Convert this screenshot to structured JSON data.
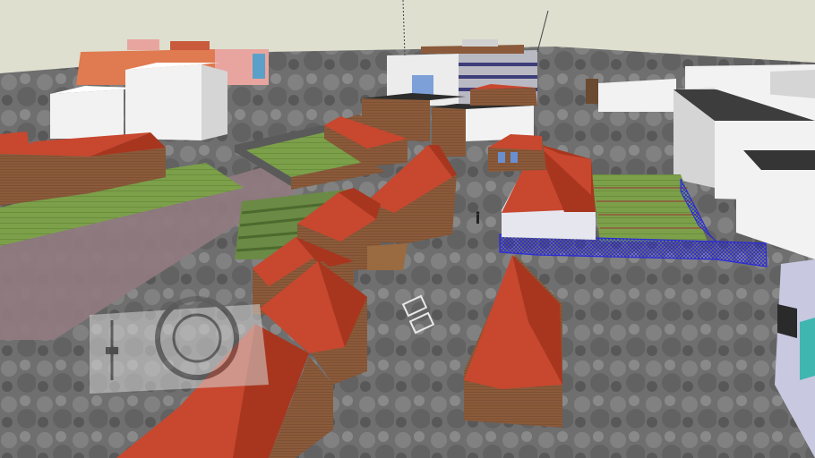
{
  "app": {
    "view": "3d-model-viewport"
  },
  "scene": {
    "colors": {
      "sky": "#dedfcf",
      "ground_dark": "#4d4d4d",
      "ground_mid": "#7a7a7a",
      "ground_light": "#a8a8a8",
      "brick": "#8a5a3a",
      "brick_dark": "#6e4528",
      "roof_red": "#c8472f",
      "roof_red_dark": "#a8361f",
      "white_block": "#f2f2f2",
      "white_side": "#d5d5d5",
      "dark_roof": "#3a3a3a",
      "grass": "#7da04a",
      "grass_dark": "#5c7d33",
      "pink_path": "#8f7a7f",
      "blue_fence": "#2a2ad8",
      "teal_glass": "#3fb6b0",
      "orange_block": "#e07a50"
    },
    "objects": [
      "orange-block-building",
      "white-block-left-1",
      "white-block-left-2",
      "tall-office-building",
      "white-block-right-1",
      "white-block-right-2",
      "white-block-right-3",
      "red-roof-terrace-left",
      "green-courtyard",
      "brick-hall",
      "red-roof-house-center",
      "red-roof-row-front-left",
      "red-roof-house-front-center",
      "white-house-red-roof",
      "allotment-garden",
      "blue-fence",
      "pink-path",
      "compass-hud",
      "blue-glass-building-right"
    ]
  }
}
